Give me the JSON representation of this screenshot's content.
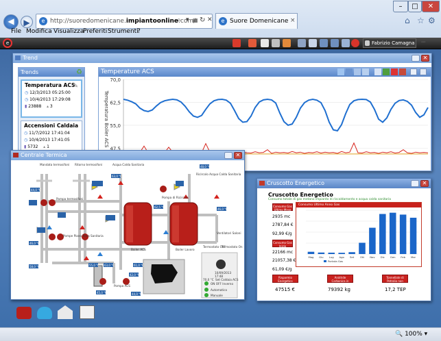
{
  "browser": {
    "url_plain": "http://suoredomenicane.",
    "url_bold": "impiantoonline",
    "url_tail": ".com/",
    "tab_title": "Suore Domenicane",
    "menu": [
      "File",
      "Modifica",
      "Visualizza",
      "Preferiti",
      "Strumenti",
      "?"
    ],
    "zoom": "100%"
  },
  "app": {
    "user": "Fabrizio Camagna"
  },
  "trend": {
    "title": "Trend",
    "trends_header": "Trends",
    "chart_header": "Temperature ACS",
    "items": [
      {
        "name": "Temperatura ACS",
        "date1": "12/3/2013 05:25:00",
        "date2": "10/4/2013 17:29:08",
        "count": "23888",
        "val": "3"
      },
      {
        "name": "Accensioni Caldaia",
        "date1": "11/7/2012 17:41:04",
        "date2": "10/4/2013 17:41:05",
        "count": "5732",
        "val": "1"
      }
    ]
  },
  "chart_data": {
    "type": "line",
    "title": "Temperature ACS",
    "ylabel": "Temperatura Boiler ACS",
    "yticks": [
      "70,0",
      "62,5",
      "55,0",
      "47,5"
    ],
    "ylim": [
      44,
      70
    ],
    "series": [
      {
        "values": [
          63.5,
          63.2,
          62.7,
          62.0,
          60.6,
          59.8,
          59.5,
          60.0,
          61.3,
          62.4,
          63.0,
          63.3,
          63.5,
          63.3,
          62.6,
          61.2,
          59.4,
          58.0,
          57.6,
          58.2,
          60.2,
          62.0,
          63.0,
          63.4,
          63.5,
          63.2,
          62.2,
          59.8,
          57.2,
          56.0,
          56.2,
          58.0,
          60.8,
          62.6,
          63.3,
          63.5,
          63.3,
          62.3,
          59.0,
          56.2,
          55.0,
          55.4,
          57.6,
          60.6,
          62.4,
          63.2,
          63.5,
          63.2,
          62.4,
          59.8,
          56.0,
          53.5,
          53.2,
          55.2,
          58.8,
          61.8,
          63.0,
          63.4,
          63.5,
          63.4,
          62.6,
          60.2,
          57.0,
          56.0,
          57.4,
          60.2,
          62.2,
          63.1,
          63.3,
          62.8,
          61.6,
          59.2,
          57.6,
          58.4,
          60.8
        ]
      },
      {
        "values": [
          46.2,
          46.0,
          46.8,
          45.9,
          46.1,
          48.2,
          46.0,
          46.3,
          45.8,
          46.4,
          46.0,
          47.8,
          46.1,
          45.9,
          46.2,
          46.0,
          46.5,
          45.8,
          46.1,
          46.0,
          49.0,
          46.2,
          45.9,
          46.3,
          46.0,
          46.1,
          45.8,
          46.4,
          46.0,
          46.2,
          46.0,
          45.9,
          46.3,
          46.0,
          46.1,
          47.0,
          45.8,
          46.2,
          46.0,
          46.1,
          45.9,
          46.4,
          46.0,
          46.2,
          45.8,
          46.1,
          46.0,
          46.3,
          45.9,
          46.2,
          46.0,
          46.1,
          45.8,
          46.4,
          46.0,
          46.2,
          49.2,
          46.0,
          45.9,
          46.3,
          46.0,
          46.1,
          45.8,
          46.2,
          46.0,
          46.3,
          45.9,
          46.1,
          47.0,
          46.0,
          45.8,
          46.2,
          46.0,
          46.1,
          46.0
        ]
      },
      {
        "values": [
          45.6,
          45.6,
          45.6,
          45.6,
          45.6,
          45.6,
          45.6,
          45.6,
          45.6,
          45.6,
          45.6,
          45.6,
          45.6,
          45.6,
          45.6,
          45.6,
          45.6,
          45.6,
          45.6,
          45.6,
          45.6,
          45.6,
          45.6,
          45.6,
          45.6,
          45.6,
          45.6,
          45.6,
          45.6,
          45.6,
          45.6,
          45.6,
          45.6,
          45.6,
          45.6,
          45.6,
          45.6,
          45.6,
          45.6,
          45.6,
          45.6,
          45.6,
          45.6,
          45.6,
          45.6,
          45.6,
          45.6,
          45.6,
          45.6,
          45.6,
          45.6,
          45.6,
          45.6,
          45.6,
          45.6,
          45.6,
          45.6,
          45.6,
          45.6,
          45.6,
          45.6,
          45.6,
          45.6,
          45.6,
          45.6,
          45.6,
          45.6,
          45.6,
          45.6,
          45.6,
          45.6,
          45.6,
          45.6,
          45.6,
          45.6
        ]
      }
    ],
    "colors": [
      "#1f6fd0",
      "#d7261e",
      "#e0a020"
    ]
  },
  "centrale": {
    "title": "Centrale Termica",
    "labels": {
      "mandata": "Mandata termosifoni",
      "ritorno": "Ritorno termosifoni",
      "acqua_calda": "Acqua Calda Sanitaria",
      "ricircolo": "Ricircolo Acqua Calda Sanitaria",
      "ventil": "Ventilatori Saloni",
      "boiler1": "Boiler ACS",
      "boiler2": "Boiler Lavoro",
      "pompa_termo": "Pompa termosifoni",
      "pompa_ricircolo": "Pompa di Ricircolo",
      "pompe_piano": "Pompe Piano Terra Sanitaria",
      "pompa_acs": "Pompa ACS"
    },
    "panel": {
      "off_label": "Termostato OFF",
      "on_label": "Termostato On",
      "date": "10/09/2013",
      "time": "17:48",
      "set_temp": "70,0 °C",
      "set_label": "Set Caldaia ACS",
      "status": [
        "ON OFF Inverno",
        "Automatico",
        "Manuale"
      ]
    },
    "temps": {
      "t1": "44,0 °C",
      "t2": "46,0 °C",
      "t3": "63,0 °C",
      "t4": "62,5 °C",
      "t5": "48,0 °C",
      "t6": "46,0 °C",
      "t7": "55,0 °C",
      "t8": "63,0 °C",
      "t9": "42,0 °C",
      "t10": "45,0 °C",
      "t11": "61,0 °C",
      "t12": "58,0 °C",
      "t13": "44,0 °C"
    }
  },
  "cruscotto": {
    "title": "Cruscotto Energetico",
    "heading": "Cruscotto Energetico",
    "subheading": "Consumo totale di gas metano impianto di riscaldamento e acqua calda sanitaria",
    "btn1": "Consumo Gas Ultimo Mese",
    "v1": "2935 mc",
    "v2": "2787,84 €",
    "v3": "92,99 €/g",
    "btn2": "Consumo Gas Inizio dell'Anno",
    "v4": "22166 mc",
    "v5": "21057,38 €",
    "v6": "61,09 €/g",
    "chart_title": "Consumo Ultimo Anno Gas",
    "bar_months": [
      "Mag",
      "Giu",
      "Lug",
      "Ago",
      "Set",
      "Ott",
      "Nov",
      "Dic",
      "Gen",
      "Feb",
      "Mar"
    ],
    "bar_values": [
      180,
      120,
      110,
      100,
      150,
      900,
      2100,
      3200,
      3300,
      3150,
      2900
    ],
    "bar_ymax": 3500,
    "legend": "Portata Gas",
    "b1_label": "Risparmio Energetico Ottenuto",
    "b1_value": "47515 €",
    "b2_label": "Anidride Carbonica in meno prodotta",
    "b2_value": "79392 kg",
    "b3_label": "Tonnellate di Petrolio non bruciate",
    "b3_value": "17,2 TEP"
  }
}
